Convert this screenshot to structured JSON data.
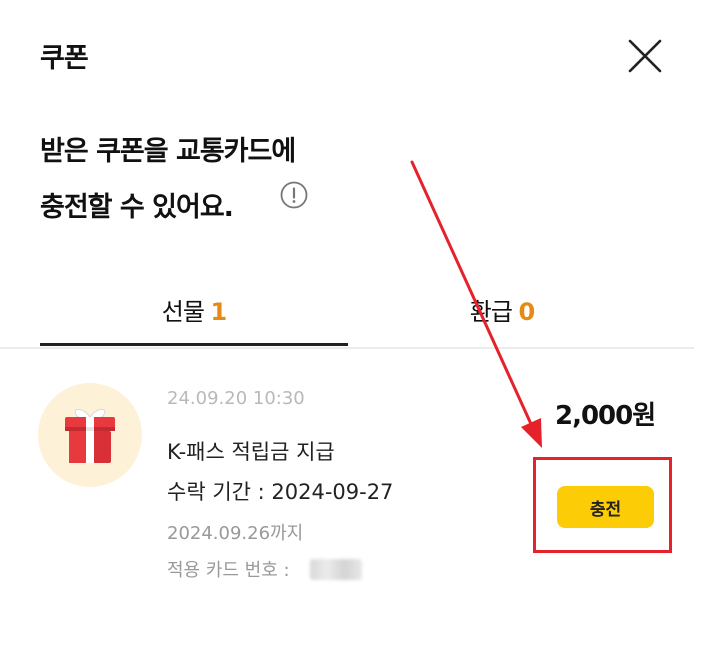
{
  "header": {
    "title": "쿠폰"
  },
  "headline": {
    "line1": "받은 쿠폰을 교통카드에",
    "line2": "충전할 수 있어요."
  },
  "tabs": [
    {
      "label": "선물",
      "count": "1",
      "active": true
    },
    {
      "label": "환급",
      "count": "0",
      "active": false
    }
  ],
  "coupon": {
    "date": "24.09.20 10:30",
    "title": "K-패스 적립금 지급",
    "period": "수락 기간 : 2024-09-27",
    "expire": "2024.09.26까지",
    "card_label": "적용 카드 번호 :",
    "amount": "2,000원",
    "charge_label": "충전"
  },
  "icons": {
    "close": "close-icon",
    "info": "info-icon",
    "gift": "gift-icon"
  },
  "colors": {
    "accent_count": "#e58a12",
    "charge_button": "#fccc07",
    "annotation_red": "#e5222b",
    "icon_bg": "#fdf1d8"
  }
}
